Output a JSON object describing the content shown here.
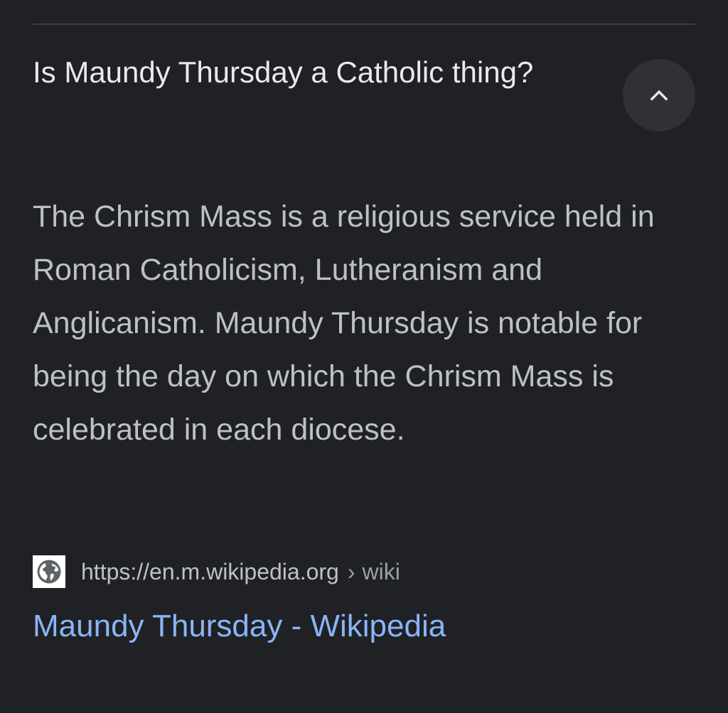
{
  "faq": {
    "question": "Is Maundy Thursday a Catholic thing?",
    "answer": "The Chrism Mass is a religious service held in Roman Catholicism, Lutheranism and Anglicanism. Maundy Thursday is notable for being the day on which the Chrism Mass is celebrated in each diocese.",
    "toggle_icon": "chevron-up-icon"
  },
  "source": {
    "favicon_icon": "globe-icon",
    "url": "https://en.m.wikipedia.org",
    "separator": "›",
    "breadcrumb": "wiki",
    "link_title": "Maundy Thursday - Wikipedia"
  },
  "colors": {
    "background": "#202124",
    "question_text": "#e8eaed",
    "answer_text": "#bdc1c6",
    "link": "#8ab4f8",
    "button_bg": "#303134"
  }
}
